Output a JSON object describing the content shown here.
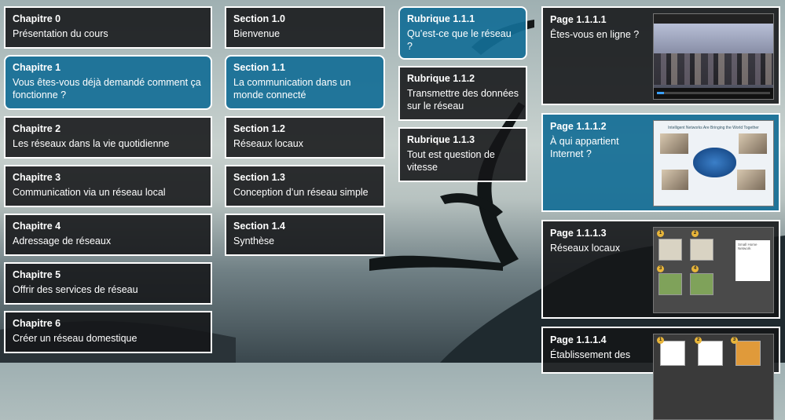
{
  "chapters": [
    {
      "title": "Chapitre 0",
      "subtitle": "Présentation du cours",
      "active": false
    },
    {
      "title": "Chapitre 1",
      "subtitle": "Vous êtes-vous déjà demandé comment ça fonctionne ?",
      "active": true
    },
    {
      "title": "Chapitre 2",
      "subtitle": "Les réseaux dans la vie quotidienne",
      "active": false
    },
    {
      "title": "Chapitre 3",
      "subtitle": "Communication via un réseau local",
      "active": false
    },
    {
      "title": "Chapitre 4",
      "subtitle": "Adressage de réseaux",
      "active": false
    },
    {
      "title": "Chapitre 5",
      "subtitle": "Offrir des services de réseau",
      "active": false
    },
    {
      "title": "Chapitre 6",
      "subtitle": "Créer un réseau domestique",
      "active": false
    }
  ],
  "sections": [
    {
      "title": "Section 1.0",
      "subtitle": "Bienvenue",
      "active": false
    },
    {
      "title": "Section 1.1",
      "subtitle": "La communication dans un monde connecté",
      "active": true
    },
    {
      "title": "Section 1.2",
      "subtitle": "Réseaux locaux",
      "active": false
    },
    {
      "title": "Section 1.3",
      "subtitle": "Conception d’un réseau simple",
      "active": false
    },
    {
      "title": "Section 1.4",
      "subtitle": "Synthèse",
      "active": false
    }
  ],
  "topics": [
    {
      "title": "Rubrique 1.1.1",
      "subtitle": "Qu’est-ce que le réseau ?",
      "active": true
    },
    {
      "title": "Rubrique 1.1.2",
      "subtitle": "Transmettre des données sur le réseau",
      "active": false
    },
    {
      "title": "Rubrique 1.1.3",
      "subtitle": "Tout est question de vitesse",
      "active": false
    }
  ],
  "pages": [
    {
      "title": "Page 1.1.1.1",
      "subtitle": "Êtes-vous en ligne ?",
      "active": false,
      "thumb": "video-thumbnail"
    },
    {
      "title": "Page 1.1.1.2",
      "subtitle": "À qui appartient Internet ?",
      "active": true,
      "thumb": "diagram-thumbnail",
      "thumb_caption": "Intelligent Networks Are Bringing the World Together"
    },
    {
      "title": "Page 1.1.1.3",
      "subtitle": "Réseaux locaux",
      "active": false,
      "thumb": "gallery-thumbnail",
      "thumb_caption": "Small Home Network"
    },
    {
      "title": "Page 1.1.1.4",
      "subtitle": "Établissement des",
      "active": false,
      "thumb": "devices-thumbnail"
    }
  ],
  "colors": {
    "active": "#146e96",
    "tile": "#141618",
    "border": "#ffffff"
  }
}
